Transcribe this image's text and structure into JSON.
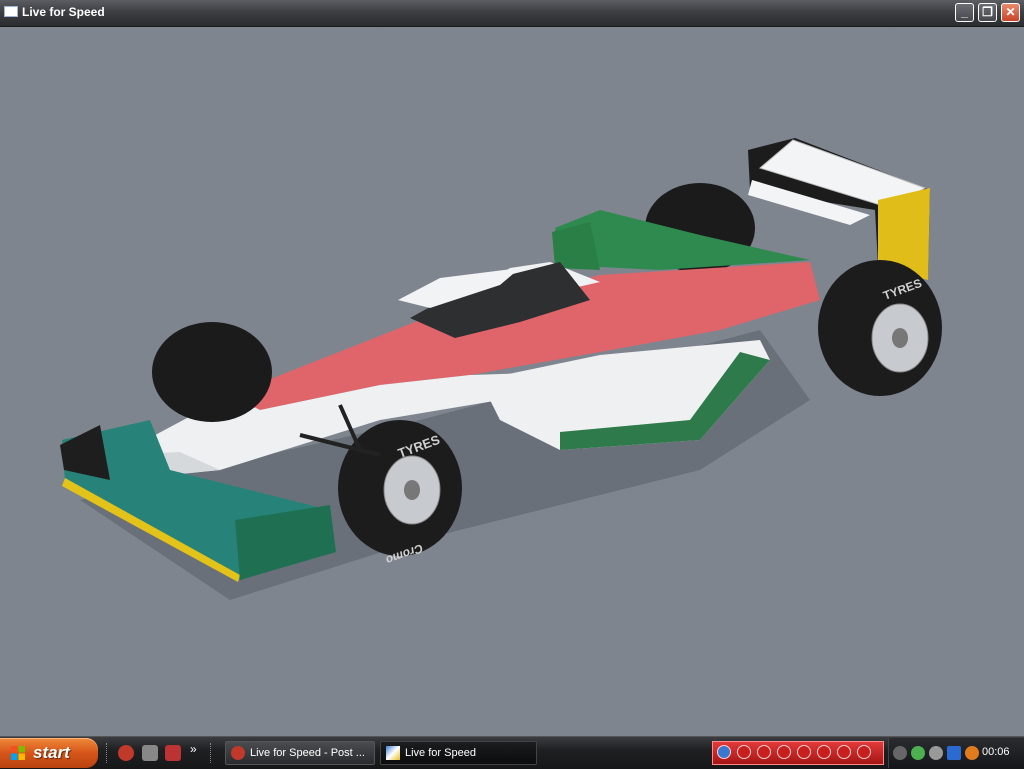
{
  "window": {
    "title": "Live for Speed",
    "buttons": {
      "minimize": "_",
      "maximize": "❐",
      "close": "✕"
    }
  },
  "scene": {
    "car_text": {
      "tyre_brand": "TYRES",
      "tyre_model": "Cromo"
    },
    "colors": {
      "background": "#7e858f",
      "green": "#2e8a4e",
      "red": "#e0656b",
      "white": "#eef0f2",
      "teal": "#2a8c7a",
      "yellow": "#e3c21a"
    }
  },
  "taskbar": {
    "start_label": "start",
    "tasks": [
      {
        "label": "Live for Speed - Post ...",
        "icon": "opera-icon"
      },
      {
        "label": "Live for Speed",
        "icon": "lfs-icon"
      }
    ],
    "clock": "00:06"
  }
}
